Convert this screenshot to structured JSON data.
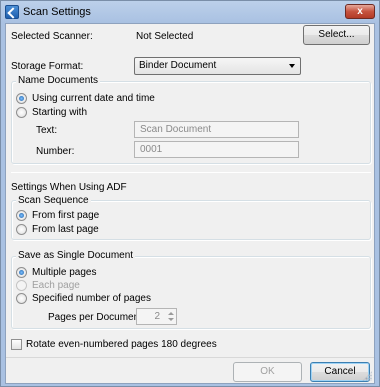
{
  "window": {
    "title": "Scan Settings",
    "close_label": "x"
  },
  "scanner": {
    "label": "Selected Scanner:",
    "value": "Not Selected",
    "select_button": "Select..."
  },
  "storage": {
    "label": "Storage Format:",
    "selected": "Binder Document"
  },
  "name_documents": {
    "legend": "Name Documents",
    "option_datetime": "Using current date and time",
    "option_starting": "Starting with",
    "text_label": "Text:",
    "text_value": "Scan Document",
    "number_label": "Number:",
    "number_value": "0001"
  },
  "adf": {
    "heading": "Settings When Using ADF",
    "scan_sequence": {
      "legend": "Scan Sequence",
      "first_page": "From first page",
      "last_page": "From last page"
    },
    "single_document": {
      "legend": "Save as Single Document",
      "multiple_pages": "Multiple pages",
      "each_page": "Each page",
      "specified_number": "Specified number of pages",
      "pages_per_doc_label": "Pages per Document:",
      "pages_per_doc_value": "2"
    }
  },
  "rotate": {
    "label": "Rotate even-numbered pages 180 degrees"
  },
  "footer": {
    "ok": "OK",
    "cancel": "Cancel"
  }
}
